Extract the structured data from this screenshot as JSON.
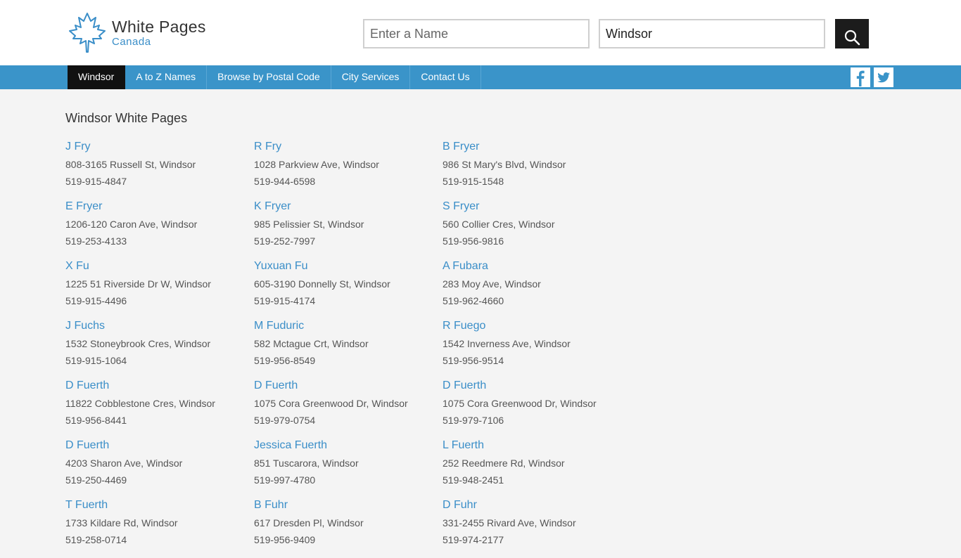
{
  "logo": {
    "title": "White Pages",
    "subtitle": "Canada"
  },
  "search": {
    "name_placeholder": "Enter a Name",
    "city_value": "Windsor",
    "button_icon": "search-icon"
  },
  "nav": {
    "items": [
      {
        "label": "Windsor",
        "active": true
      },
      {
        "label": "A to Z Names"
      },
      {
        "label": "Browse by Postal Code"
      },
      {
        "label": "City Services"
      },
      {
        "label": "Contact Us"
      }
    ],
    "social_icons": [
      "facebook-icon",
      "twitter-icon"
    ]
  },
  "colors": {
    "accent": "#3a94c9",
    "link": "#3a8ec8",
    "active_nav": "#111111",
    "background": "#f4f4f4"
  },
  "page_title": "Windsor White Pages",
  "listings": [
    {
      "name": "J Fry",
      "address": "808-3165 Russell St, Windsor",
      "phone": "519-915-4847"
    },
    {
      "name": "R Fry",
      "address": "1028 Parkview Ave, Windsor",
      "phone": "519-944-6598"
    },
    {
      "name": "B Fryer",
      "address": "986 St Mary's Blvd, Windsor",
      "phone": "519-915-1548"
    },
    {
      "name": "E Fryer",
      "address": "1206-120 Caron Ave, Windsor",
      "phone": "519-253-4133"
    },
    {
      "name": "K Fryer",
      "address": "985 Pelissier St, Windsor",
      "phone": "519-252-7997"
    },
    {
      "name": "S Fryer",
      "address": "560 Collier Cres, Windsor",
      "phone": "519-956-9816"
    },
    {
      "name": "X Fu",
      "address": "1225 51 Riverside Dr W, Windsor",
      "phone": "519-915-4496"
    },
    {
      "name": "Yuxuan Fu",
      "address": "605-3190 Donnelly St, Windsor",
      "phone": "519-915-4174"
    },
    {
      "name": "A Fubara",
      "address": "283 Moy Ave, Windsor",
      "phone": "519-962-4660"
    },
    {
      "name": "J Fuchs",
      "address": "1532 Stoneybrook Cres, Windsor",
      "phone": "519-915-1064"
    },
    {
      "name": "M Fuduric",
      "address": "582 Mctague Crt, Windsor",
      "phone": "519-956-8549"
    },
    {
      "name": "R Fuego",
      "address": "1542 Inverness Ave, Windsor",
      "phone": "519-956-9514"
    },
    {
      "name": "D Fuerth",
      "address": "11822 Cobblestone Cres, Windsor",
      "phone": "519-956-8441"
    },
    {
      "name": "D Fuerth",
      "address": "1075 Cora Greenwood Dr, Windsor",
      "phone": "519-979-0754"
    },
    {
      "name": "D Fuerth",
      "address": "1075 Cora Greenwood Dr, Windsor",
      "phone": "519-979-7106"
    },
    {
      "name": "D Fuerth",
      "address": "4203 Sharon Ave, Windsor",
      "phone": "519-250-4469"
    },
    {
      "name": "Jessica Fuerth",
      "address": "851 Tuscarora, Windsor",
      "phone": "519-997-4780"
    },
    {
      "name": "L Fuerth",
      "address": "252 Reedmere Rd, Windsor",
      "phone": "519-948-2451"
    },
    {
      "name": "T Fuerth",
      "address": "1733 Kildare Rd, Windsor",
      "phone": "519-258-0714"
    },
    {
      "name": "B Fuhr",
      "address": "617 Dresden Pl, Windsor",
      "phone": "519-956-9409"
    },
    {
      "name": "D Fuhr",
      "address": "331-2455 Rivard Ave, Windsor",
      "phone": "519-974-2177"
    }
  ]
}
